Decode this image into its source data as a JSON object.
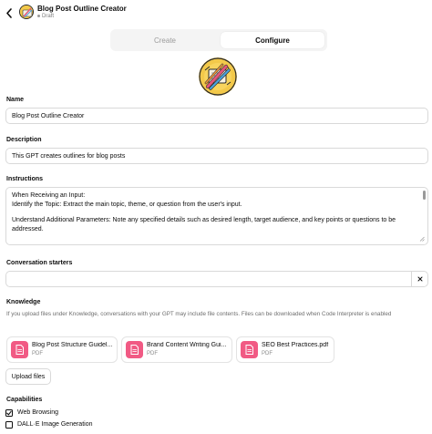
{
  "header": {
    "title": "Blog Post Outline Creator",
    "status": "Draft"
  },
  "tabs": {
    "create": "Create",
    "configure": "Configure",
    "active": "configure"
  },
  "form": {
    "name": {
      "label": "Name",
      "value": "Blog Post Outline Creator"
    },
    "description": {
      "label": "Description",
      "value": "This GPT creates outlines for blog posts"
    },
    "instructions": {
      "label": "Instructions",
      "lines": [
        "When Receiving an Input:",
        "Identify the Topic: Extract the main topic, theme, or question from the user's input.",
        "Understand Additional Parameters: Note any specified details such as desired length, target audience, and key points or questions to be",
        "addressed."
      ]
    },
    "conversation_starters": {
      "label": "Conversation starters",
      "value": ""
    }
  },
  "knowledge": {
    "label": "Knowledge",
    "description": "If you upload files under Knowledge, conversations with your GPT may include file contents. Files can be downloaded when Code Interpreter is enabled",
    "files": [
      {
        "name": "Blog Post Structure Guidel...",
        "type": "PDF"
      },
      {
        "name": "Brand Content Writing Gui...",
        "type": "PDF"
      },
      {
        "name": "SEO Best Practices.pdf",
        "type": "PDF"
      }
    ],
    "upload_label": "Upload files"
  },
  "capabilities": {
    "label": "Capabilities",
    "items": [
      {
        "label": "Web Browsing",
        "checked": true
      },
      {
        "label": "DALL·E Image Generation",
        "checked": false
      }
    ]
  },
  "colors": {
    "file_icon": "#f15a84",
    "active_tab_bg": "#ffffff",
    "tabs_bg": "#f4f4f4",
    "border": "#d9d9d9",
    "avatar_bg": "#f3c94a"
  },
  "icons": {
    "back": "chevron-left-icon",
    "clear": "close-icon",
    "file": "document-icon",
    "check": "check-icon",
    "resize": "resize-handle-icon"
  }
}
